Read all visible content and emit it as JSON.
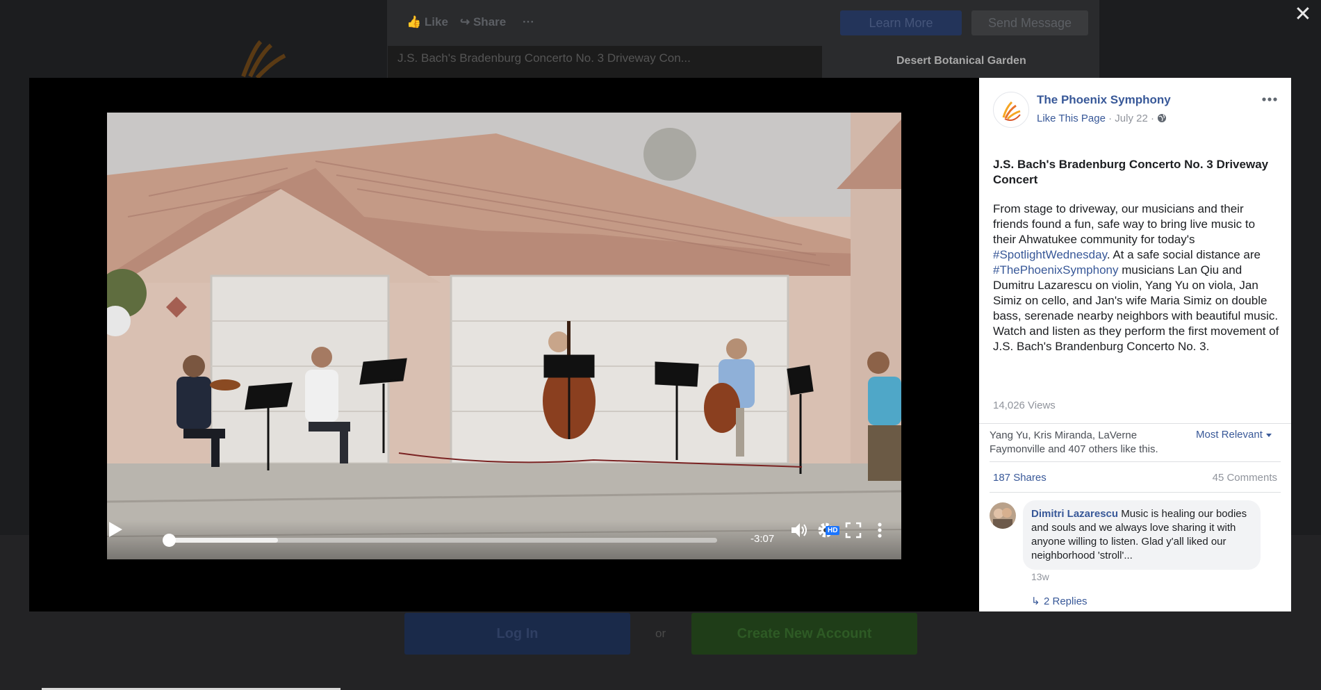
{
  "background": {
    "like_label": "Like",
    "share_label": "Share",
    "more_label": "···",
    "learn_more_label": "Learn More",
    "send_message_label": "Send Message",
    "video_thumb_title": "J.S. Bach's Bradenburg Concerto No. 3 Driveway Con...",
    "related_page": "Desert Botanical Garden",
    "login_label": "Log In",
    "or_label": "or",
    "create_account_label": "Create New Account"
  },
  "modal": {
    "close_label": "✕"
  },
  "player": {
    "time_remaining": "-3:07",
    "hd_label": "HD",
    "progress_fraction": 0.0,
    "buffered_fraction": 0.2
  },
  "post": {
    "page_name": "The Phoenix Symphony",
    "like_page_label": "Like This Page",
    "date": "July 22",
    "title": "J.S. Bach's Bradenburg Concerto No. 3 Driveway Concert",
    "body_part1": "From stage to driveway, our musicians and their friends found a fun, safe way to bring live music to their Ahwatukee community for today's ",
    "hashtag1": "#SpotlightWednesday",
    "body_part2": ". At a safe social distance are ",
    "hashtag2": "#ThePhoenixSymphony",
    "body_part3": " musicians Lan Qiu and Dumitru Lazarescu on violin, Yang Yu on viola, Jan Simiz on cello, and Jan's wife Maria Simiz on double bass, serenade nearby neighbors with beautiful music. Watch and listen as they perform the first movement of J.S. Bach's Brandenburg Concerto No. 3.",
    "views": "14,026 Views",
    "likes_text": "Yang Yu, Kris Miranda, LaVerne Faymonville and 407 others like this.",
    "sort_label": "Most Relevant",
    "shares": "187 Shares",
    "comments_count": "45 Comments"
  },
  "comment": {
    "author": "Dimitri Lazarescu",
    "text": " Music is healing our bodies and souls and we always love sharing it with anyone willing to listen. Glad y'all liked our neighborhood 'stroll'...",
    "time": "13w",
    "replies_label": "2 Replies"
  },
  "colors": {
    "link_blue": "#385898",
    "meta_gray": "#90949c",
    "brand_orange": "#f5a623"
  }
}
